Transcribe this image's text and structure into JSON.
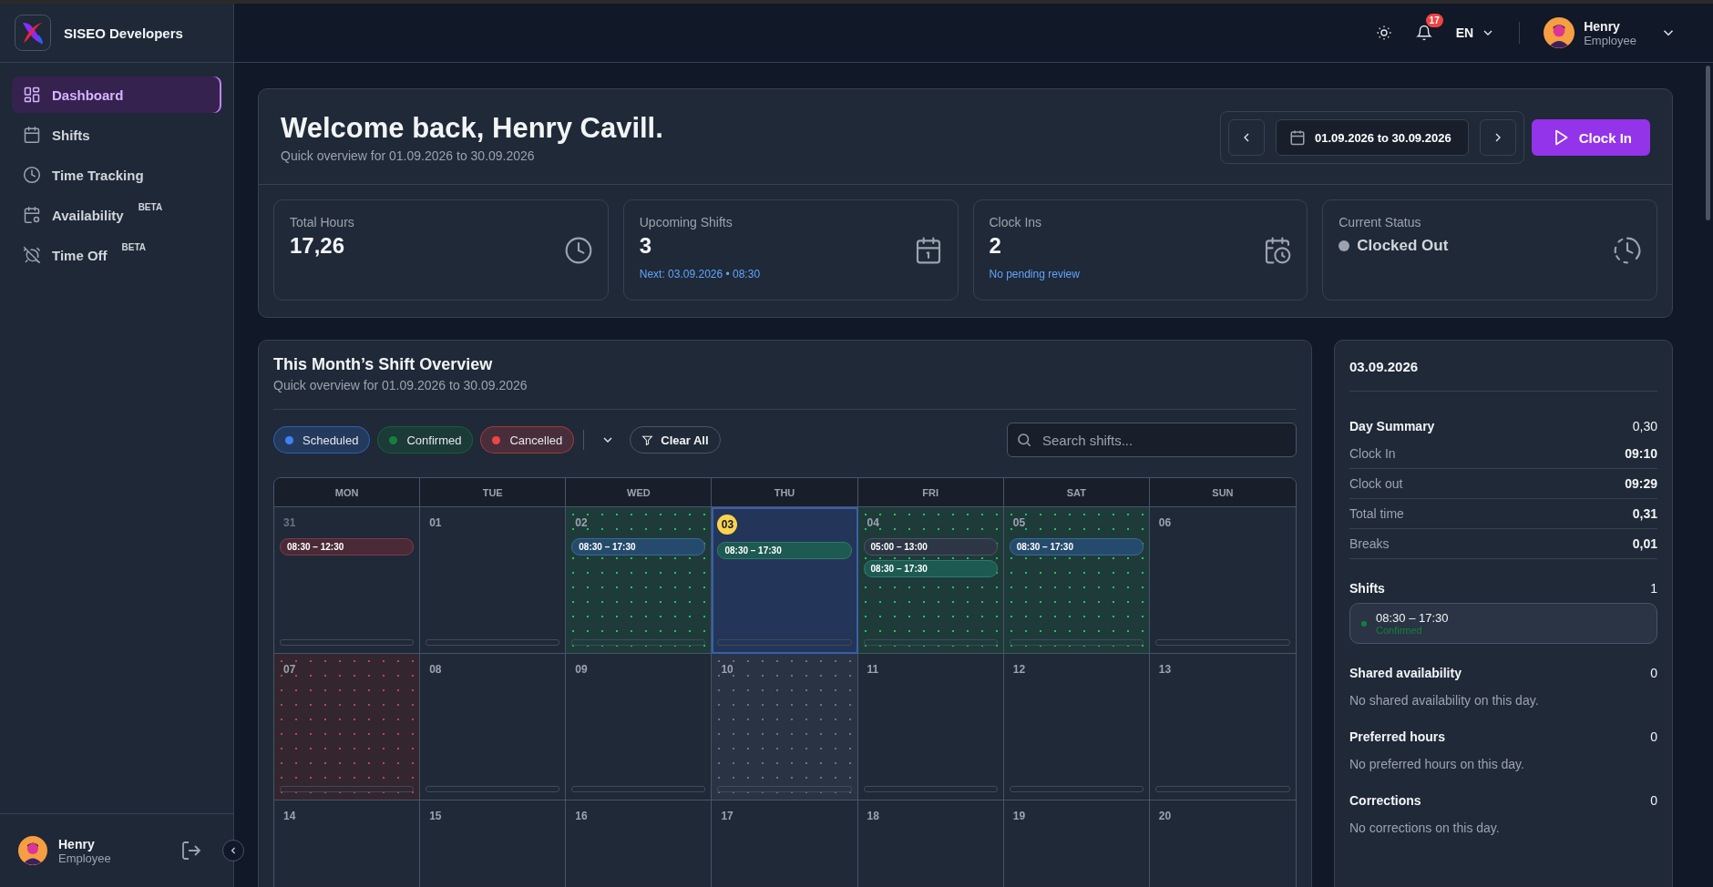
{
  "sidebar": {
    "brand": "SISEO Developers",
    "items": [
      {
        "label": "Dashboard",
        "selected": true
      },
      {
        "label": "Shifts",
        "selected": false
      },
      {
        "label": "Time Tracking",
        "selected": false
      },
      {
        "label": "Availability",
        "badge": "BETA",
        "selected": false
      },
      {
        "label": "Time Off",
        "badge": "BETA",
        "selected": false
      }
    ],
    "user": {
      "name": "Henry",
      "role": "Employee"
    }
  },
  "topbar": {
    "notifications": "17",
    "language": "EN",
    "user": {
      "name": "Henry",
      "role": "Employee"
    }
  },
  "header": {
    "title": "Welcome back, Henry Cavill.",
    "subtitle": "Quick overview for 01.09.2026 to 30.09.2026",
    "date_range": "01.09.2026 to 30.09.2026",
    "clock_in": "Clock In"
  },
  "stats": [
    {
      "label": "Total Hours",
      "value": "17,26",
      "kind": "number"
    },
    {
      "label": "Upcoming Shifts",
      "value": "3",
      "note": "Next: 03.09.2026 • 08:30",
      "kind": "number"
    },
    {
      "label": "Clock Ins",
      "value": "2",
      "note": "No pending review",
      "kind": "number"
    },
    {
      "label": "Current Status",
      "value": "Clocked Out",
      "kind": "status"
    }
  ],
  "calendar": {
    "title": "This Month’s Shift Overview",
    "subtitle": "Quick overview for 01.09.2026 to 30.09.2026",
    "filters": [
      {
        "label": "Scheduled",
        "color": "#3b82f6"
      },
      {
        "label": "Confirmed",
        "color": "#15803d"
      },
      {
        "label": "Cancelled",
        "color": "#ef4444"
      }
    ],
    "clear": "Clear All",
    "search_placeholder": "Search shifts...",
    "weekdays": [
      "MON",
      "TUE",
      "WED",
      "THU",
      "FRI",
      "SAT",
      "SUN"
    ],
    "weeks": [
      [
        {
          "day": "31",
          "outside": true,
          "today": false,
          "selected": false,
          "kind": "plain",
          "shifts": [
            {
              "time": "08:30 – 12:30",
              "kind": "cancelled"
            }
          ]
        },
        {
          "day": "01",
          "outside": false,
          "today": false,
          "selected": false,
          "kind": "plain"
        },
        {
          "day": "02",
          "outside": false,
          "today": false,
          "selected": false,
          "kind": "available",
          "shifts": [
            {
              "time": "08:30 – 17:30",
              "kind": "scheduled"
            }
          ]
        },
        {
          "day": "03",
          "outside": false,
          "today": true,
          "selected": true,
          "kind": "plain",
          "shifts": [
            {
              "time": "08:30 – 17:30",
              "kind": "confirmed"
            }
          ]
        },
        {
          "day": "04",
          "outside": false,
          "today": false,
          "selected": false,
          "kind": "available",
          "shifts": [
            {
              "time": "05:00 – 13:00",
              "kind": "other"
            },
            {
              "time": "08:30 – 17:30",
              "kind": "confirmed"
            }
          ]
        },
        {
          "day": "05",
          "outside": false,
          "today": false,
          "selected": false,
          "kind": "available",
          "shifts": [
            {
              "time": "08:30 – 17:30",
              "kind": "scheduled"
            }
          ]
        },
        {
          "day": "06",
          "outside": false,
          "today": false,
          "selected": false,
          "kind": "plain"
        }
      ],
      [
        {
          "day": "07",
          "outside": false,
          "today": false,
          "selected": false,
          "kind": "unavailable"
        },
        {
          "day": "08",
          "outside": false,
          "today": false,
          "selected": false,
          "kind": "plain"
        },
        {
          "day": "09",
          "outside": false,
          "today": false,
          "selected": false,
          "kind": "plain"
        },
        {
          "day": "10",
          "outside": false,
          "today": false,
          "selected": false,
          "kind": "off"
        },
        {
          "day": "11",
          "outside": false,
          "today": false,
          "selected": false,
          "kind": "plain"
        },
        {
          "day": "12",
          "outside": false,
          "today": false,
          "selected": false,
          "kind": "plain"
        },
        {
          "day": "13",
          "outside": false,
          "today": false,
          "selected": false,
          "kind": "plain"
        }
      ],
      [
        {
          "day": "14",
          "outside": false,
          "today": false,
          "selected": false,
          "kind": "plain"
        },
        {
          "day": "15",
          "outside": false,
          "today": false,
          "selected": false,
          "kind": "plain"
        },
        {
          "day": "16",
          "outside": false,
          "today": false,
          "selected": false,
          "kind": "plain"
        },
        {
          "day": "17",
          "outside": false,
          "today": false,
          "selected": false,
          "kind": "plain"
        },
        {
          "day": "18",
          "outside": false,
          "today": false,
          "selected": false,
          "kind": "plain"
        },
        {
          "day": "19",
          "outside": false,
          "today": false,
          "selected": false,
          "kind": "plain"
        },
        {
          "day": "20",
          "outside": false,
          "today": false,
          "selected": false,
          "kind": "plain"
        }
      ]
    ]
  },
  "day_panel": {
    "date": "03.09.2026",
    "summary": {
      "label": "Day Summary",
      "value": "0,30",
      "rows": [
        {
          "label": "Clock In",
          "value": "09:10"
        },
        {
          "label": "Clock out",
          "value": "09:29"
        },
        {
          "label": "Total time",
          "value": "0,31"
        },
        {
          "label": "Breaks",
          "value": "0,01"
        }
      ]
    },
    "shifts": {
      "label": "Shifts",
      "count": "1",
      "items": [
        {
          "time": "08:30 – 17:30",
          "status": "Confirmed",
          "color": "#15803d"
        }
      ]
    },
    "sections": [
      {
        "label": "Shared availability",
        "count": "0",
        "empty": "No shared availability on this day."
      },
      {
        "label": "Preferred hours",
        "count": "0",
        "empty": "No preferred hours on this day."
      },
      {
        "label": "Corrections",
        "count": "0",
        "empty": "No corrections on this day."
      }
    ]
  }
}
